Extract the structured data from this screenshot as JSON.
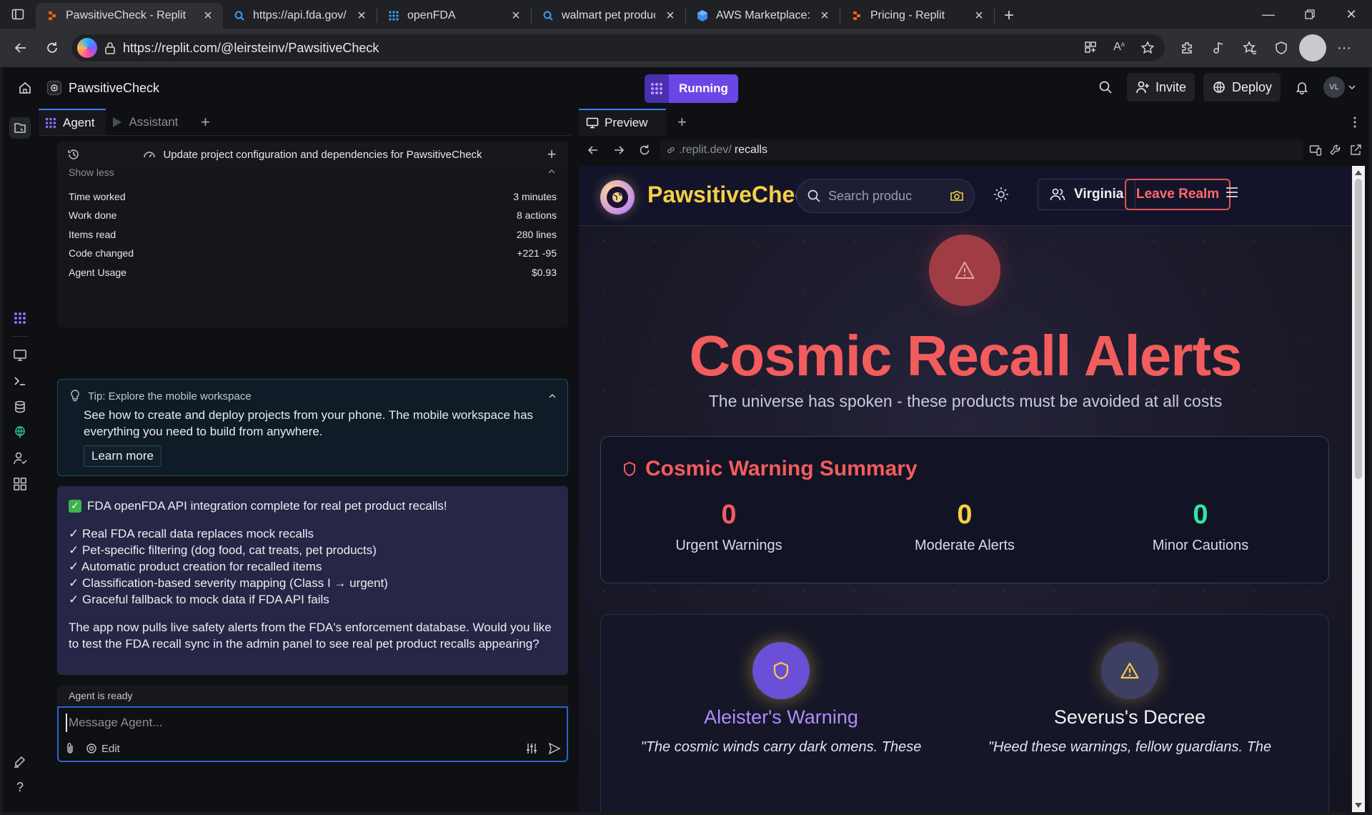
{
  "browser": {
    "tabs": [
      {
        "title": "PawsitiveCheck - Replit",
        "icon": "replit-favicon",
        "active": true
      },
      {
        "title": "https://api.fda.gov/ - Search",
        "icon": "search-favicon"
      },
      {
        "title": "openFDA",
        "icon": "openfda-favicon"
      },
      {
        "title": "walmart pet product databa",
        "icon": "search-favicon"
      },
      {
        "title": "AWS Marketplace: Walmart F",
        "icon": "aws-favicon"
      },
      {
        "title": "Pricing - Replit",
        "icon": "replit-favicon"
      }
    ],
    "url": "https://replit.com/@leirsteinv/PawsitiveCheck"
  },
  "replit": {
    "project_name": "PawsitiveCheck",
    "run_status": "Running",
    "invite_label": "Invite",
    "deploy_label": "Deploy",
    "user_initials": "VL"
  },
  "agent_panel": {
    "tabs": [
      {
        "label": "Agent",
        "active": true
      },
      {
        "label": "Assistant",
        "active": false
      }
    ],
    "thread_title": "Update project configuration and dependencies for PawsitiveCheck",
    "show_less": "Show less",
    "stats": [
      {
        "label": "Time worked",
        "value": "3 minutes"
      },
      {
        "label": "Work done",
        "value": "8 actions"
      },
      {
        "label": "Items read",
        "value": "280 lines"
      },
      {
        "label": "Code changed",
        "value": "+221 -95"
      },
      {
        "label": "Agent Usage",
        "value": "$0.93"
      }
    ],
    "tip": {
      "title": "Tip: Explore the mobile workspace",
      "body": "See how to create and deploy projects from your phone. The mobile workspace has everything you need to build from anywhere.",
      "button": "Learn more"
    },
    "message": {
      "headline": "FDA openFDA API integration complete for real pet product recalls!",
      "bullets": [
        "✓ Real FDA recall data replaces mock recalls",
        "✓ Pet-specific filtering (dog food, cat treats, pet products)",
        "✓ Automatic product creation for recalled items",
        "✓ Classification-based severity mapping (Class I → urgent)",
        "✓ Graceful fallback to mock data if FDA API fails"
      ],
      "closing": "The app now pulls live safety alerts from the FDA's enforcement database. Would you like to test the FDA recall sync in the admin panel to see real pet product recalls appearing?"
    },
    "status": "Agent is ready",
    "composer": {
      "placeholder": "Message Agent...",
      "edit_label": "Edit"
    }
  },
  "preview_panel": {
    "tab_label": "Preview",
    "url_prefix": ".replit.dev/",
    "url_path": "recalls"
  },
  "site": {
    "brand": "PawsitiveCheck",
    "search_placeholder": "Search produc",
    "user_name": "Virginia",
    "leave_label": "Leave Realm",
    "title": "Cosmic Recall Alerts",
    "subtitle": "The universe has spoken - these products must be avoided at all costs",
    "summary": {
      "title": "Cosmic Warning Summary",
      "stats": [
        {
          "value": "0",
          "label": "Urgent Warnings",
          "color": "#f25c5c"
        },
        {
          "value": "0",
          "label": "Moderate Alerts",
          "color": "#f5cf45"
        },
        {
          "value": "0",
          "label": "Minor Cautions",
          "color": "#2ee6a6"
        }
      ]
    },
    "guardians": [
      {
        "name": "Aleister's Warning",
        "quote": "\"The cosmic winds carry dark omens. These",
        "color": "#b18cff",
        "icon": "shield-icon"
      },
      {
        "name": "Severus's Decree",
        "quote": "\"Heed these warnings, fellow guardians. The",
        "color": "#f0f0f4",
        "icon": "warning-triangle-icon"
      }
    ]
  }
}
